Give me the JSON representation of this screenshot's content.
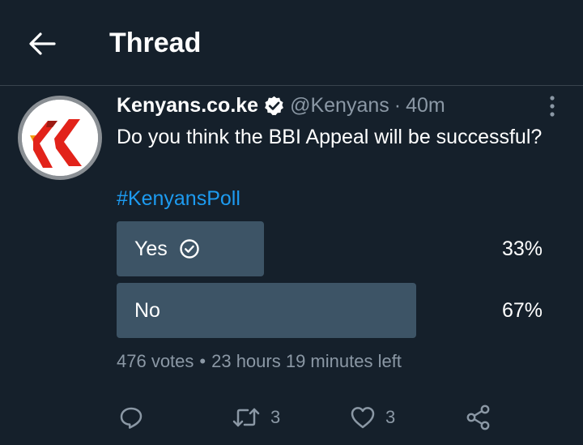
{
  "header": {
    "title": "Thread",
    "back_icon": "arrow-left-icon"
  },
  "tweet": {
    "display_name": "Kenyans.co.ke",
    "handle": "@Kenyans",
    "separator": "·",
    "time": "40m",
    "text": "Do you think the BBI Appeal will be successful?",
    "hashtag": "#KenyansPoll",
    "verified_icon": "verified-badge-icon",
    "more_icon": "more-vertical-icon",
    "avatar_colors": {
      "accent": "#e2231a",
      "accent_dark": "#9c1b14",
      "orange": "#f39c12"
    }
  },
  "poll": {
    "options": [
      {
        "label": "Yes",
        "percent_text": "33%",
        "fraction": 0.33,
        "chosen": true
      },
      {
        "label": "No",
        "percent_text": "67%",
        "fraction": 0.67,
        "chosen": false
      }
    ],
    "votes": "476 votes",
    "bullet": "•",
    "time_left": "23 hours 19 minutes left"
  },
  "actions": {
    "reply_icon": "reply-icon",
    "retweet_icon": "retweet-icon",
    "retweet_count": "3",
    "like_icon": "heart-icon",
    "like_count": "3",
    "share_icon": "share-icon"
  },
  "colors": {
    "background": "#15202b",
    "divider": "#38444d",
    "secondary_text": "#8b98a5",
    "link": "#1d9bf0",
    "poll_bar": "#3d5466"
  }
}
